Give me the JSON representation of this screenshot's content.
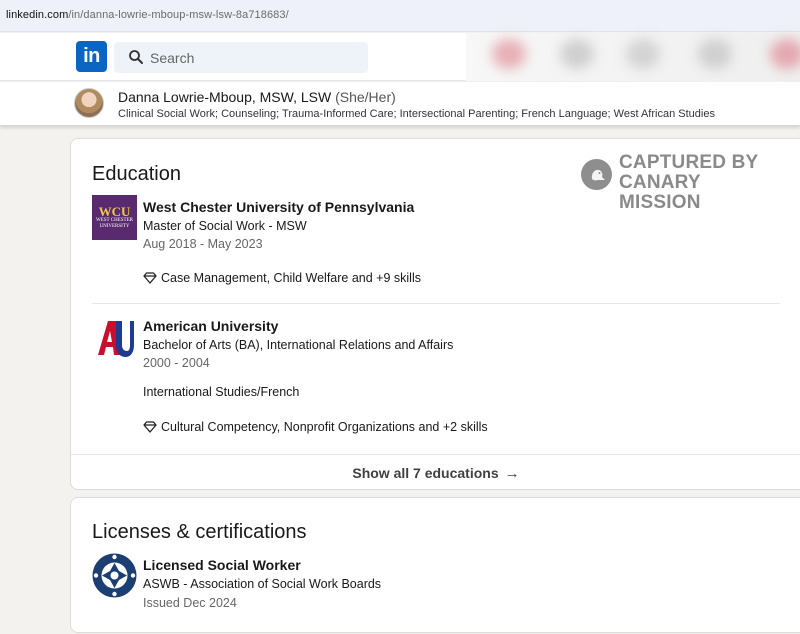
{
  "browser": {
    "url_domain": "linkedin.com",
    "url_path": "/in/danna-lowrie-mboup-msw-lsw-8a718683/"
  },
  "nav": {
    "logo_text": "in",
    "search_placeholder": "Search"
  },
  "sticky_header": {
    "name": "Danna Lowrie-Mboup, MSW, LSW",
    "pronouns": "(She/Her)",
    "headline": "Clinical Social Work; Counseling; Trauma-Informed Care; Intersectional Parenting; French Language; West African Studies"
  },
  "watermark": {
    "line1": "CAPTURED BY",
    "line2": "CANARY MISSION"
  },
  "education": {
    "title": "Education",
    "entries": [
      {
        "logo_text": "WCU",
        "logo_subtext": "WEST CHESTER UNIVERSITY",
        "school": "West Chester University of Pennsylvania",
        "degree": "Master of Social Work - MSW",
        "dates": "Aug 2018 - May 2023",
        "skills": "Case Management, Child Welfare and +9 skills"
      },
      {
        "school": "American University",
        "degree": "Bachelor of Arts (BA), International Relations and Affairs",
        "dates": "2000 - 2004",
        "description": "International Studies/French",
        "skills": "Cultural Competency, Nonprofit Organizations and +2 skills"
      }
    ],
    "show_all_label": "Show all 7 educations",
    "show_all_arrow": "→"
  },
  "licenses": {
    "title": "Licenses & certifications",
    "entries": [
      {
        "name": "Licensed Social Worker",
        "issuer": "ASWB - Association of Social Work Boards",
        "issued": "Issued Dec 2024"
      }
    ]
  },
  "colors": {
    "brand": "#0a66c2",
    "wcu_purple": "#5a2a6e",
    "au_red": "#c8102e",
    "au_blue": "#1f3a93",
    "aswb_navy": "#1c3f73"
  }
}
